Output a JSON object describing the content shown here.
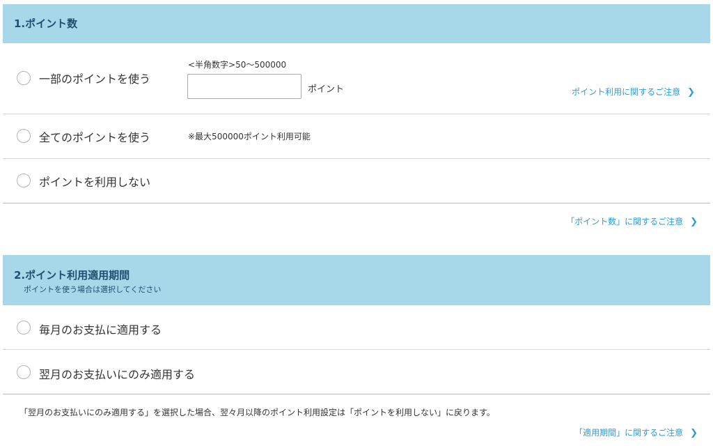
{
  "section1": {
    "title": "1.ポイント数",
    "options": [
      {
        "label": "一部のポイントを使う"
      },
      {
        "label": "全てのポイントを使う"
      },
      {
        "label": "ポイントを利用しない"
      }
    ],
    "input_hint": "<半角数字>50〜500000",
    "input_value": "",
    "input_unit": "ポイント",
    "usage_link": "ポイント利用に関するご注意",
    "max_note": "※最大500000ポイント利用可能",
    "footer_link": "「ポイント数」に関するご注意"
  },
  "section2": {
    "title": "2.ポイント利用適用期間",
    "subtitle": "ポイントを使う場合は選択してください",
    "options": [
      {
        "label": "毎月のお支払に適用する"
      },
      {
        "label": "翌月のお支払いにのみ適用する"
      }
    ],
    "note": "「翌月のお支払いにのみ適用する」を選択した場合、翌々月以降のポイント利用設定は「ポイントを利用しない」に戻ります。",
    "footer_link": "「適用期間」に関するご注意"
  },
  "icons": {
    "chevron": "chevron-right-icon"
  },
  "colors": {
    "header_bg": "#a6d8ea",
    "header_text": "#1f4e6e",
    "link": "#2d9bd4",
    "divider": "#d9d9d9"
  }
}
